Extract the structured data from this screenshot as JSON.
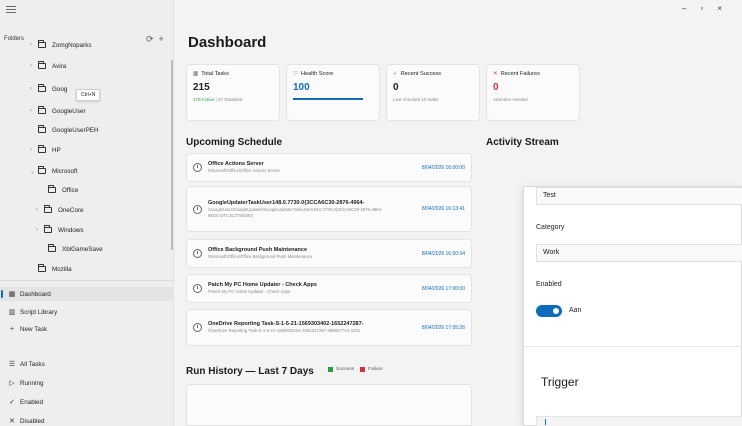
{
  "window": {
    "controls": [
      "–",
      "▫",
      "×"
    ]
  },
  "sidebar": {
    "folders_label": "Folders",
    "folder_tree": [
      {
        "label": "ZomgNoparks",
        "chevron": "›"
      },
      {
        "label": "Avira",
        "chevron": "›"
      },
      {
        "label": "Goog",
        "chevron": "›"
      },
      {
        "label": "GoogleUser",
        "chevron": "›"
      },
      {
        "label": "GoogleUserPEH",
        "chevron": ""
      },
      {
        "label": "HP",
        "chevron": "›"
      },
      {
        "label": "Microsoft",
        "chevron": "⌄"
      },
      {
        "label": "Office",
        "chevron": ""
      },
      {
        "label": "OneCore",
        "chevron": "›"
      },
      {
        "label": "Windows",
        "chevron": "›"
      },
      {
        "label": "XblGameSave",
        "chevron": ""
      },
      {
        "label": "Mozilla",
        "chevron": ""
      }
    ],
    "tooltip": "Ctrl+N",
    "nav": [
      {
        "label": "Dashboard",
        "icon": "▦"
      },
      {
        "label": "Script Library",
        "icon": "▥"
      },
      {
        "label": "New Task",
        "icon": "+"
      },
      {
        "label": "All Tasks",
        "icon": "☰"
      },
      {
        "label": "Running",
        "icon": "▷"
      },
      {
        "label": "Enabled",
        "icon": "✓"
      },
      {
        "label": "Disabled",
        "icon": "✕"
      }
    ]
  },
  "main": {
    "title": "Dashboard",
    "cards": {
      "total": {
        "title": "Total Tasks",
        "value": "215",
        "active": "178 Active",
        "sep": "|",
        "disabled": "37 Disabled"
      },
      "health": {
        "title": "Health Score",
        "value": "100"
      },
      "success": {
        "title": "Recent Success",
        "value": "0",
        "sub": "Last checked 10 tasks"
      },
      "failures": {
        "title": "Recent Failures",
        "value": "0",
        "sub": "Attention needed"
      }
    },
    "upcoming_title": "Upcoming Schedule",
    "activity_title": "Activity Stream",
    "schedule": [
      {
        "name": "Office Actions Server",
        "path": "\\Microsoft\\Office\\Office Actions Server",
        "time": "8/04/2026 16:00:00"
      },
      {
        "name": "GoogleUpdaterTaskUser148.0.7730.0{3CCA6C30-2876-4964-",
        "path": "\\GoogleUser\\GoogleUpdater\\GoogleUpdaterTaskUser148.0.7730.0{3CCA6C30-2876-4964-95DC-DTC3C7750400}",
        "time": "8/04/2026 16:13:41"
      },
      {
        "name": "Office Background Push Maintenance",
        "path": "\\Microsoft\\Office\\Office Background Push Maintenance",
        "time": "8/04/2026 16:50:34"
      },
      {
        "name": "Patch My PC Home Updater - Check Apps",
        "path": "\\Patch My PC Home Updater - Check Apps",
        "time": "8/04/2026 17:00:00"
      },
      {
        "name": "OneDrive Reporting Task-S-1-5-21-1569303402-1652247287-",
        "path": "\\OneDrive Reporting Task-S-1-5-21-1569303402-1652247287-4955077V1-1001",
        "time": "8/04/2026 17:05:26"
      }
    ],
    "run_history": {
      "title": "Run History — Last 7 Days",
      "legend_success": "Success",
      "legend_failure": "Failure"
    },
    "colors": {
      "accent": "#0f6cbd",
      "success": "#2e9a3e",
      "failure": "#d13438"
    }
  },
  "dialog": {
    "name_value": "Test",
    "category_label": "Category",
    "category_value": "Work",
    "enabled_label": "Enabled",
    "enabled_state": "Aan",
    "trigger_heading": "Trigger"
  }
}
